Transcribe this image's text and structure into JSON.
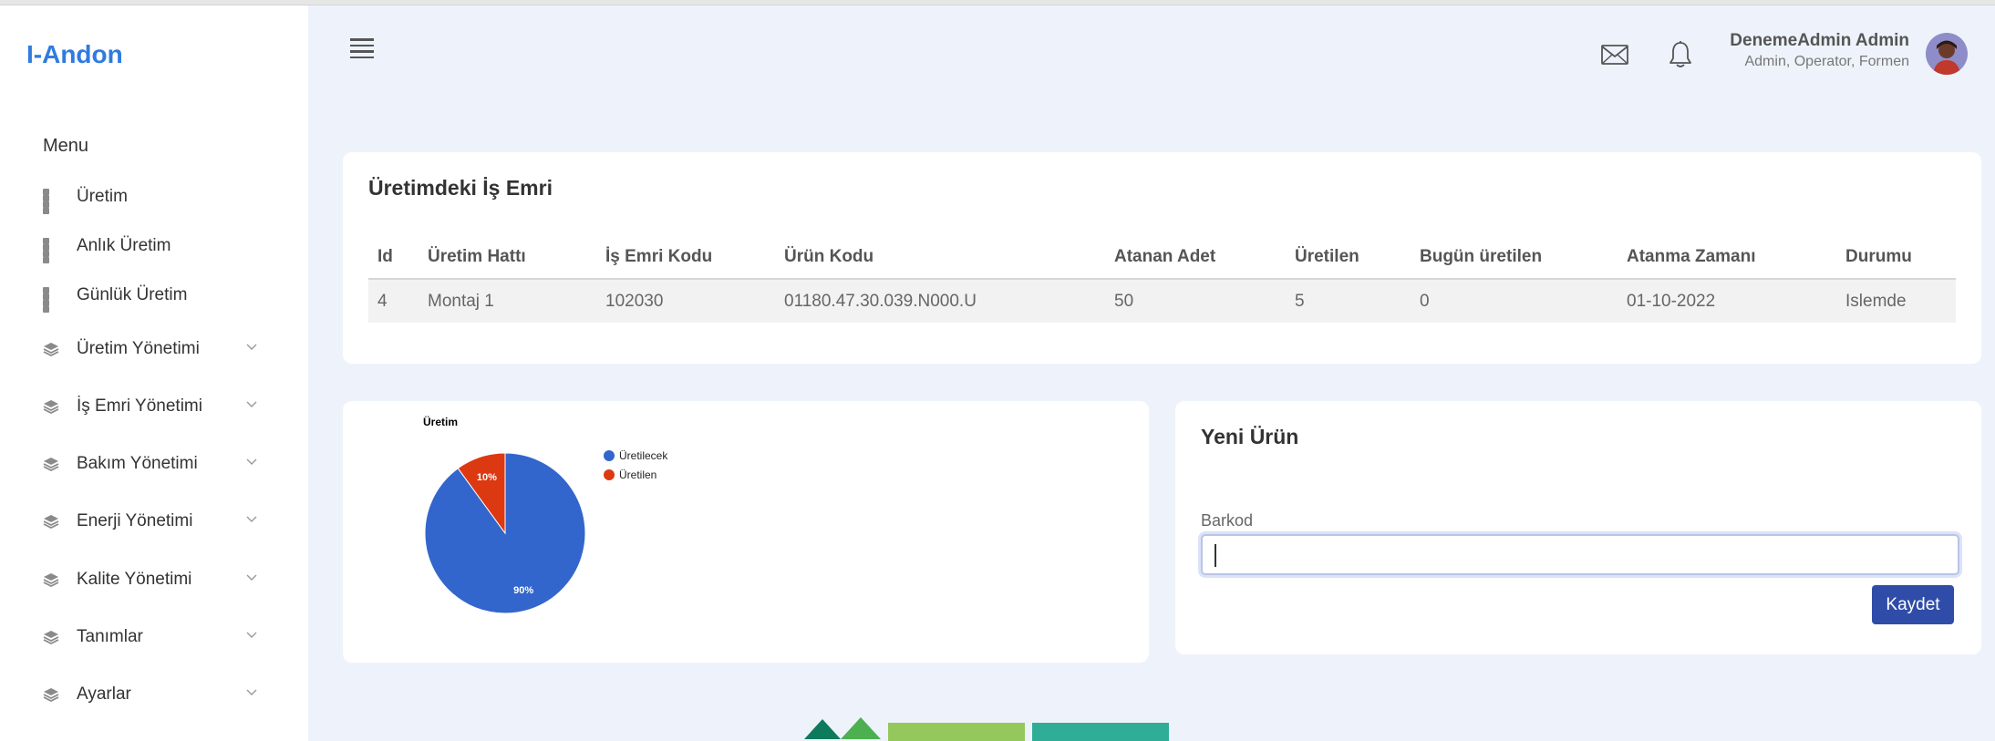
{
  "app": {
    "brand": "I-Andon"
  },
  "sidebar": {
    "menu_title": "Menu",
    "items": [
      {
        "label": "Üretim",
        "icon": "grid-icon",
        "expandable": false
      },
      {
        "label": "Anlık Üretim",
        "icon": "grid-icon",
        "expandable": false
      },
      {
        "label": "Günlük Üretim",
        "icon": "grid-icon",
        "expandable": false
      },
      {
        "label": "Üretim Yönetimi",
        "icon": "layers-icon",
        "expandable": true
      },
      {
        "label": "İş Emri Yönetimi",
        "icon": "layers-icon",
        "expandable": true
      },
      {
        "label": "Bakım Yönetimi",
        "icon": "layers-icon",
        "expandable": true
      },
      {
        "label": "Enerji Yönetimi",
        "icon": "layers-icon",
        "expandable": true
      },
      {
        "label": "Kalite Yönetimi",
        "icon": "layers-icon",
        "expandable": true
      },
      {
        "label": "Tanımlar",
        "icon": "layers-icon",
        "expandable": true
      },
      {
        "label": "Ayarlar",
        "icon": "layers-icon",
        "expandable": true
      }
    ]
  },
  "header": {
    "user_name": "DenemeAdmin Admin",
    "user_roles": "Admin, Operator, Formen"
  },
  "work_orders": {
    "title": "Üretimdeki İş Emri",
    "columns": [
      "Id",
      "Üretim Hattı",
      "İş Emri Kodu",
      "Ürün Kodu",
      "Atanan Adet",
      "Üretilen",
      "Bugün üretilen",
      "Atanma Zamanı",
      "Durumu"
    ],
    "rows": [
      [
        "4",
        "Montaj 1",
        "102030",
        "01180.47.30.039.N000.U",
        "50",
        "5",
        "0",
        "01-10-2022",
        "Islemde"
      ]
    ]
  },
  "chart_data": {
    "type": "pie",
    "title": "Üretim",
    "legend_position": "right",
    "slices": [
      {
        "name": "Üretilecek",
        "value": 90,
        "label": "90%",
        "color": "#3366cc"
      },
      {
        "name": "Üretilen",
        "value": 10,
        "label": "10%",
        "color": "#dc3912"
      }
    ]
  },
  "new_product": {
    "title": "Yeni Ürün",
    "barcode_label": "Barkod",
    "barcode_value": "",
    "save_label": "Kaydet"
  },
  "colors": {
    "brand": "#2f7be0",
    "button": "#2f4da8",
    "background": "#eef3fb"
  }
}
